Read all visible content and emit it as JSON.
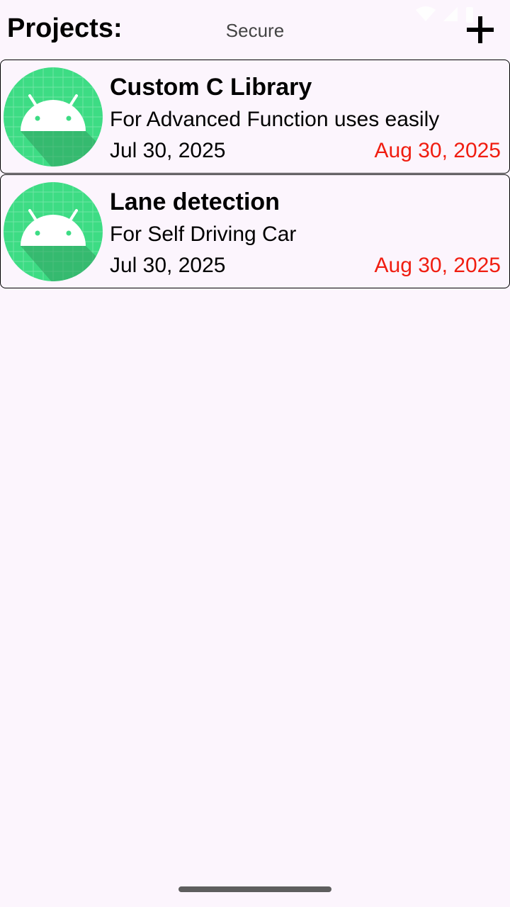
{
  "header": {
    "title": "Projects:",
    "status": "Secure",
    "add_icon": "plus-icon"
  },
  "projects": [
    {
      "name": "Custom C Library",
      "description": "For Advanced Function uses easily",
      "start_date": "Jul 30, 2025",
      "due_date": "Aug 30, 2025",
      "icon": "android-app-icon"
    },
    {
      "name": "Lane detection",
      "description": "For Self Driving Car",
      "start_date": "Jul 30, 2025",
      "due_date": "Aug 30, 2025",
      "icon": "android-app-icon"
    }
  ],
  "colors": {
    "background": "#fcf5fd",
    "due_date": "#f01d10",
    "avatar_green": "#3ddc84"
  }
}
